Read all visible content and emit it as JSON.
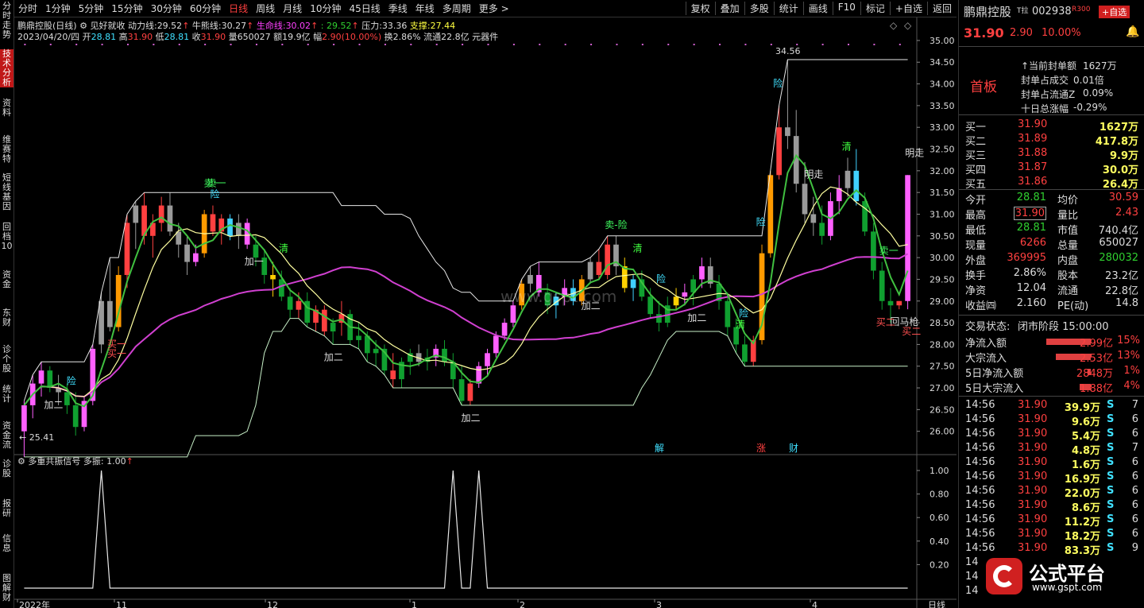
{
  "toolbar": {
    "periods": [
      "分时",
      "1分钟",
      "5分钟",
      "15分钟",
      "30分钟",
      "60分钟",
      "日线",
      "周线",
      "月线",
      "10分钟",
      "45日线",
      "季线",
      "年线",
      "多周期",
      "更多 >"
    ],
    "active": "日线",
    "right": [
      "复权",
      "叠加",
      "多股",
      "统计",
      "画线",
      "F10",
      "标记",
      "+自选",
      "返回"
    ]
  },
  "leftstrip": [
    "分时走势",
    "技术分析",
    "资料",
    "维赛特",
    "短线基因",
    "回档10",
    "资金",
    "东财",
    "诊个股",
    "统计",
    "资金流",
    "诊股",
    "报研",
    "信息",
    "图解财"
  ],
  "info": {
    "stock": "鹏鼎控股(日线)",
    "formula": "见好就收",
    "dongli_label": "动力线:",
    "dongli": "29.52",
    "niuxiong_label": "牛熊线:",
    "niuxiong": "30.27",
    "sheng_label": "生命线:",
    "sheng": "30.02",
    "extra": ": 29.52",
    "ya_label": "压力:",
    "ya": "33.36",
    "zhi_label": "支撑:",
    "zhi": "27.44",
    "date": "2023/04/20/四",
    "open_label": "开",
    "open": "28.81",
    "high_label": "高",
    "high": "31.90",
    "low_label": "低",
    "low": "28.81",
    "close_label": "收",
    "close": "31.90",
    "vol_label": "量",
    "vol": "650027",
    "amt_label": "额",
    "amt": "19.9亿",
    "chg_label": "幅",
    "chg": "2.90(10.00%)",
    "turn_label": "换",
    "turn": "2.86%",
    "float_label": "流通",
    "float": "22.8亿",
    "sector": "元器件"
  },
  "yaxis": [
    "35.00",
    "34.50",
    "34.00",
    "33.50",
    "33.00",
    "32.50",
    "32.00",
    "31.50",
    "31.00",
    "30.50",
    "30.00",
    "29.50",
    "29.00",
    "28.50",
    "28.00",
    "27.50",
    "27.00",
    "26.50",
    "26.00"
  ],
  "sub": {
    "title": "多重共振信号",
    "label": "多振:",
    "value": "1.00",
    "yaxis": [
      "1.00",
      "0.80",
      "0.60",
      "0.40",
      "0.20"
    ]
  },
  "xaxis": [
    "2022年",
    "11",
    "12",
    "1",
    "2",
    "3",
    "4"
  ],
  "xaxis_right": "日线",
  "annotations": [
    "险",
    "卖一",
    "险",
    "卖一",
    "加二",
    "清",
    "加二",
    "险",
    "卖-险",
    "清",
    "加二",
    "险",
    "清",
    "险",
    "卖一",
    "明走",
    "清",
    "明走",
    "回马枪",
    "买二",
    "加一",
    "加二",
    "买二",
    "买一",
    "加二",
    "险",
    "买一"
  ],
  "price_labels": {
    "low": "25.41",
    "high": "34.56"
  },
  "events": [
    "解",
    "涨",
    "财"
  ],
  "watermark_url": "www.gspt.com",
  "rp": {
    "name": "鹏鼎控股",
    "suffix": "T拉",
    "code": "002938",
    "tag": "R300",
    "add": "+自选",
    "price": "31.90",
    "change": "2.90",
    "pct": "10.00%",
    "board": "首板",
    "seal": [
      {
        "label": "↑当前封单额",
        "value": "1627万"
      },
      {
        "label": "封单占成交",
        "value": "0.01倍"
      },
      {
        "label": "封单占流通Z",
        "value": "0.09%"
      },
      {
        "label": "十日总涨幅",
        "value": "-0.29%"
      }
    ],
    "book": [
      {
        "label": "买一",
        "price": "31.90",
        "vol": "1627万"
      },
      {
        "label": "买二",
        "price": "31.89",
        "vol": "417.8万"
      },
      {
        "label": "买三",
        "price": "31.88",
        "vol": "9.9万"
      },
      {
        "label": "买四",
        "price": "31.87",
        "vol": "30.0万"
      },
      {
        "label": "买五",
        "price": "31.86",
        "vol": "26.4万"
      }
    ],
    "stats": [
      {
        "l1": "今开",
        "v1": "28.81",
        "l2": "均价",
        "v2": "30.59"
      },
      {
        "l1": "最高",
        "v1": "31.90",
        "l2": "量比",
        "v2": "2.43"
      },
      {
        "l1": "最低",
        "v1": "28.81",
        "l2": "市值",
        "v2": "740.4亿"
      },
      {
        "l1": "现量",
        "v1": "6266",
        "l2": "总量",
        "v2": "650027"
      },
      {
        "l1": "外盘",
        "v1": "369995",
        "l2": "内盘",
        "v2": "280032"
      },
      {
        "l1": "换手",
        "v1": "2.86%",
        "l2": "股本",
        "v2": "23.2亿"
      },
      {
        "l1": "净资",
        "v1": "12.04",
        "l2": "流通",
        "v2": "22.8亿"
      },
      {
        "l1": "收益㈣",
        "v1": "2.160",
        "l2": "PE(动)",
        "v2": "14.8"
      }
    ],
    "status_label": "交易状态:",
    "status": "闭市阶段 15:00:00",
    "flows": [
      {
        "label": "净流入额",
        "value": "2.99亿",
        "pct": "15%"
      },
      {
        "label": "大宗流入",
        "value": "2.53亿",
        "pct": "13%"
      },
      {
        "label": "5日净流入额",
        "value": "2848万",
        "pct": "1%"
      },
      {
        "label": "5日大宗流入",
        "value": "1.88亿",
        "pct": "4%"
      }
    ],
    "ticks": [
      {
        "t": "14:56",
        "p": "31.90",
        "v": "39.9万",
        "s": "S",
        "n": "7"
      },
      {
        "t": "14:56",
        "p": "31.90",
        "v": "9.6万",
        "s": "S",
        "n": "6"
      },
      {
        "t": "14:56",
        "p": "31.90",
        "v": "5.4万",
        "s": "S",
        "n": "6"
      },
      {
        "t": "14:56",
        "p": "31.90",
        "v": "4.8万",
        "s": "S",
        "n": "7"
      },
      {
        "t": "14:56",
        "p": "31.90",
        "v": "1.6万",
        "s": "S",
        "n": "6"
      },
      {
        "t": "14:56",
        "p": "31.90",
        "v": "16.9万",
        "s": "S",
        "n": "6"
      },
      {
        "t": "14:56",
        "p": "31.90",
        "v": "22.0万",
        "s": "S",
        "n": "6"
      },
      {
        "t": "14:56",
        "p": "31.90",
        "v": "8.6万",
        "s": "S",
        "n": "6"
      },
      {
        "t": "14:56",
        "p": "31.90",
        "v": "11.2万",
        "s": "S",
        "n": "6"
      },
      {
        "t": "14:56",
        "p": "31.90",
        "v": "18.2万",
        "s": "S",
        "n": "6"
      },
      {
        "t": "14:56",
        "p": "31.90",
        "v": "83.3万",
        "s": "S",
        "n": "9"
      }
    ],
    "ticks_more": [
      "14",
      "14",
      "14"
    ],
    "logo_text": "公式平台",
    "logo_url": "www.gspt.com"
  },
  "colors": {
    "up": "#ff4040",
    "down": "#10a030",
    "magenta": "#ff60ff",
    "cyan": "#40d0ff",
    "yellow": "#ffd000",
    "gray": "#9a9a9a"
  },
  "chart_data": {
    "type": "candlestick",
    "ylim": [
      25.5,
      35.2
    ],
    "candles": [
      [
        26.0,
        26.7,
        25.41,
        26.6,
        "m"
      ],
      [
        26.6,
        27.3,
        26.3,
        27.1,
        "m"
      ],
      [
        27.1,
        27.6,
        26.8,
        27.4,
        "m"
      ],
      [
        27.4,
        27.5,
        26.9,
        27.0,
        "g"
      ],
      [
        27.0,
        27.3,
        26.6,
        26.9,
        "gy"
      ],
      [
        26.9,
        27.1,
        26.4,
        26.6,
        "g"
      ],
      [
        26.6,
        26.9,
        25.9,
        26.1,
        "g"
      ],
      [
        26.1,
        26.8,
        26.0,
        26.7,
        "m"
      ],
      [
        26.7,
        28.0,
        26.6,
        27.9,
        "m"
      ],
      [
        28.0,
        29.2,
        27.8,
        29.0,
        "gy"
      ],
      [
        29.0,
        30.0,
        28.3,
        28.4,
        "gy"
      ],
      [
        28.4,
        29.8,
        28.3,
        29.6,
        "o"
      ],
      [
        29.6,
        31.0,
        29.3,
        30.8,
        "r"
      ],
      [
        30.8,
        31.3,
        30.2,
        31.2,
        "gy"
      ],
      [
        31.2,
        31.5,
        30.3,
        30.5,
        "r"
      ],
      [
        30.5,
        31.0,
        30.0,
        30.8,
        "r"
      ],
      [
        30.8,
        31.4,
        30.6,
        31.2,
        "r"
      ],
      [
        31.2,
        31.5,
        30.5,
        30.6,
        "gy"
      ],
      [
        30.6,
        30.8,
        30.0,
        30.3,
        "gy"
      ],
      [
        30.3,
        30.5,
        29.6,
        29.9,
        "gy"
      ],
      [
        29.9,
        30.3,
        29.8,
        30.1,
        "m"
      ],
      [
        30.1,
        31.1,
        30.0,
        31.0,
        "o"
      ],
      [
        31.0,
        31.2,
        30.5,
        30.6,
        "r"
      ],
      [
        30.6,
        31.0,
        30.3,
        30.9,
        "r"
      ],
      [
        30.9,
        31.0,
        30.4,
        30.5,
        "c"
      ],
      [
        30.5,
        31.0,
        30.2,
        30.8,
        "gy"
      ],
      [
        30.8,
        30.9,
        30.2,
        30.3,
        "m"
      ],
      [
        30.3,
        30.5,
        29.8,
        30.0,
        "g"
      ],
      [
        30.0,
        30.2,
        29.4,
        29.6,
        "g"
      ],
      [
        29.6,
        29.9,
        29.1,
        29.5,
        "y"
      ],
      [
        29.5,
        29.7,
        29.0,
        29.1,
        "g"
      ],
      [
        29.1,
        29.3,
        28.6,
        28.8,
        "g"
      ],
      [
        28.8,
        29.2,
        28.6,
        29.0,
        "r"
      ],
      [
        29.0,
        29.2,
        28.4,
        28.5,
        "g"
      ],
      [
        28.5,
        28.9,
        28.3,
        28.8,
        "r"
      ],
      [
        28.8,
        28.9,
        28.2,
        28.3,
        "r"
      ],
      [
        28.3,
        28.6,
        28.0,
        28.5,
        "g"
      ],
      [
        28.5,
        29.0,
        28.2,
        28.7,
        "r"
      ],
      [
        28.7,
        28.8,
        28.0,
        28.1,
        "g"
      ],
      [
        28.1,
        28.5,
        27.9,
        28.2,
        "g"
      ],
      [
        28.2,
        28.3,
        27.6,
        27.8,
        "g"
      ],
      [
        27.8,
        28.1,
        27.5,
        27.9,
        "g"
      ],
      [
        27.9,
        28.0,
        27.3,
        27.4,
        "g"
      ],
      [
        27.4,
        27.8,
        27.0,
        27.2,
        "r"
      ],
      [
        27.2,
        27.7,
        27.0,
        27.6,
        "g"
      ],
      [
        27.6,
        27.9,
        27.3,
        27.8,
        "g"
      ],
      [
        27.8,
        28.0,
        27.5,
        27.6,
        "gy"
      ],
      [
        27.6,
        27.9,
        27.4,
        27.7,
        "g"
      ],
      [
        27.7,
        28.0,
        27.5,
        27.9,
        "m"
      ],
      [
        27.9,
        28.1,
        27.5,
        27.6,
        "g"
      ],
      [
        27.6,
        27.8,
        27.0,
        27.2,
        "g"
      ],
      [
        27.2,
        27.5,
        26.6,
        26.7,
        "g"
      ],
      [
        26.7,
        27.2,
        26.6,
        27.1,
        "r"
      ],
      [
        27.1,
        27.6,
        27.0,
        27.5,
        "m"
      ],
      [
        27.5,
        27.9,
        27.3,
        27.8,
        "m"
      ],
      [
        27.8,
        28.3,
        27.7,
        28.2,
        "m"
      ],
      [
        28.2,
        28.6,
        28.1,
        28.5,
        "m"
      ],
      [
        28.5,
        29.0,
        28.4,
        28.9,
        "m"
      ],
      [
        28.9,
        29.5,
        28.8,
        29.4,
        "o"
      ],
      [
        29.4,
        29.8,
        29.2,
        29.6,
        "gy"
      ],
      [
        29.6,
        29.9,
        29.1,
        29.2,
        "m"
      ],
      [
        29.2,
        29.4,
        28.7,
        28.9,
        "g"
      ],
      [
        28.9,
        29.2,
        28.6,
        29.1,
        "c"
      ],
      [
        29.1,
        29.5,
        28.9,
        29.3,
        "m"
      ],
      [
        29.3,
        29.5,
        28.9,
        29.0,
        "c"
      ],
      [
        29.0,
        29.6,
        28.9,
        29.5,
        "o"
      ],
      [
        29.5,
        30.0,
        29.4,
        29.9,
        "gy"
      ],
      [
        29.9,
        30.2,
        29.5,
        29.6,
        "r"
      ],
      [
        29.6,
        30.5,
        29.5,
        30.3,
        "r"
      ],
      [
        30.3,
        30.5,
        29.6,
        29.8,
        "gy"
      ],
      [
        29.8,
        30.0,
        29.2,
        29.3,
        "y"
      ],
      [
        29.3,
        29.6,
        29.0,
        29.5,
        "c"
      ],
      [
        29.5,
        29.7,
        29.0,
        29.1,
        "g"
      ],
      [
        29.1,
        29.3,
        28.6,
        28.7,
        "g"
      ],
      [
        28.7,
        29.0,
        28.3,
        28.5,
        "g"
      ],
      [
        28.5,
        29.1,
        28.4,
        28.9,
        "g"
      ],
      [
        28.9,
        29.3,
        28.8,
        29.1,
        "y"
      ],
      [
        29.1,
        29.4,
        28.9,
        29.2,
        "m"
      ],
      [
        29.2,
        29.6,
        28.9,
        29.5,
        "g"
      ],
      [
        29.5,
        30.0,
        29.3,
        29.8,
        "m"
      ],
      [
        29.8,
        30.0,
        29.3,
        29.4,
        "gy"
      ],
      [
        29.4,
        29.6,
        28.8,
        29.0,
        "g"
      ],
      [
        29.0,
        29.2,
        28.2,
        28.4,
        "g"
      ],
      [
        28.4,
        28.6,
        27.8,
        28.0,
        "g"
      ],
      [
        28.0,
        28.2,
        27.5,
        27.6,
        "g"
      ],
      [
        27.6,
        28.2,
        27.5,
        28.1,
        "r"
      ],
      [
        28.1,
        30.3,
        28.0,
        30.1,
        "o"
      ],
      [
        30.1,
        32.0,
        30.0,
        31.9,
        "o"
      ],
      [
        31.9,
        33.5,
        31.8,
        33.0,
        "r"
      ],
      [
        33.0,
        34.56,
        32.5,
        32.8,
        "gy"
      ],
      [
        32.8,
        33.4,
        31.5,
        31.7,
        "gy"
      ],
      [
        31.7,
        32.2,
        30.8,
        31.0,
        "gy"
      ],
      [
        31.0,
        31.4,
        30.5,
        30.8,
        "gy"
      ],
      [
        30.8,
        31.2,
        30.3,
        30.5,
        "g"
      ],
      [
        30.5,
        31.5,
        30.4,
        31.3,
        "m"
      ],
      [
        31.3,
        31.9,
        31.0,
        31.6,
        "m"
      ],
      [
        31.6,
        32.3,
        31.4,
        32.0,
        "gy"
      ],
      [
        32.0,
        32.5,
        31.2,
        31.3,
        "c"
      ],
      [
        31.3,
        31.5,
        30.5,
        30.6,
        "g"
      ],
      [
        30.6,
        30.8,
        29.5,
        29.7,
        "g"
      ],
      [
        29.7,
        29.9,
        28.8,
        29.0,
        "g"
      ],
      [
        29.0,
        29.3,
        28.5,
        28.9,
        "g"
      ],
      [
        28.9,
        29.0,
        28.81,
        29.0,
        "r"
      ],
      [
        29.0,
        31.9,
        28.81,
        31.9,
        "m"
      ]
    ],
    "sub_signal": [
      0,
      0,
      0,
      0,
      0,
      0,
      0,
      0,
      0,
      0,
      0,
      0,
      0,
      0,
      0,
      0,
      0,
      0,
      0,
      0,
      0,
      0,
      0,
      0,
      0,
      0,
      0,
      0,
      0,
      0,
      0,
      0,
      0,
      0,
      0,
      0,
      0,
      0,
      0,
      0,
      0,
      0,
      0,
      0,
      0,
      0,
      0,
      0,
      0,
      0,
      0,
      0,
      0,
      0,
      0,
      0,
      0,
      0,
      0,
      0,
      0,
      0,
      0,
      0,
      0,
      0,
      0,
      0,
      0,
      0,
      0,
      0,
      0,
      0,
      0,
      0,
      0,
      0,
      0,
      0,
      0,
      0,
      0,
      0,
      0,
      0,
      0,
      0,
      0,
      0,
      0,
      0,
      0,
      0,
      0,
      0,
      0,
      0,
      0,
      0,
      0,
      0,
      0,
      0,
      1
    ]
  }
}
